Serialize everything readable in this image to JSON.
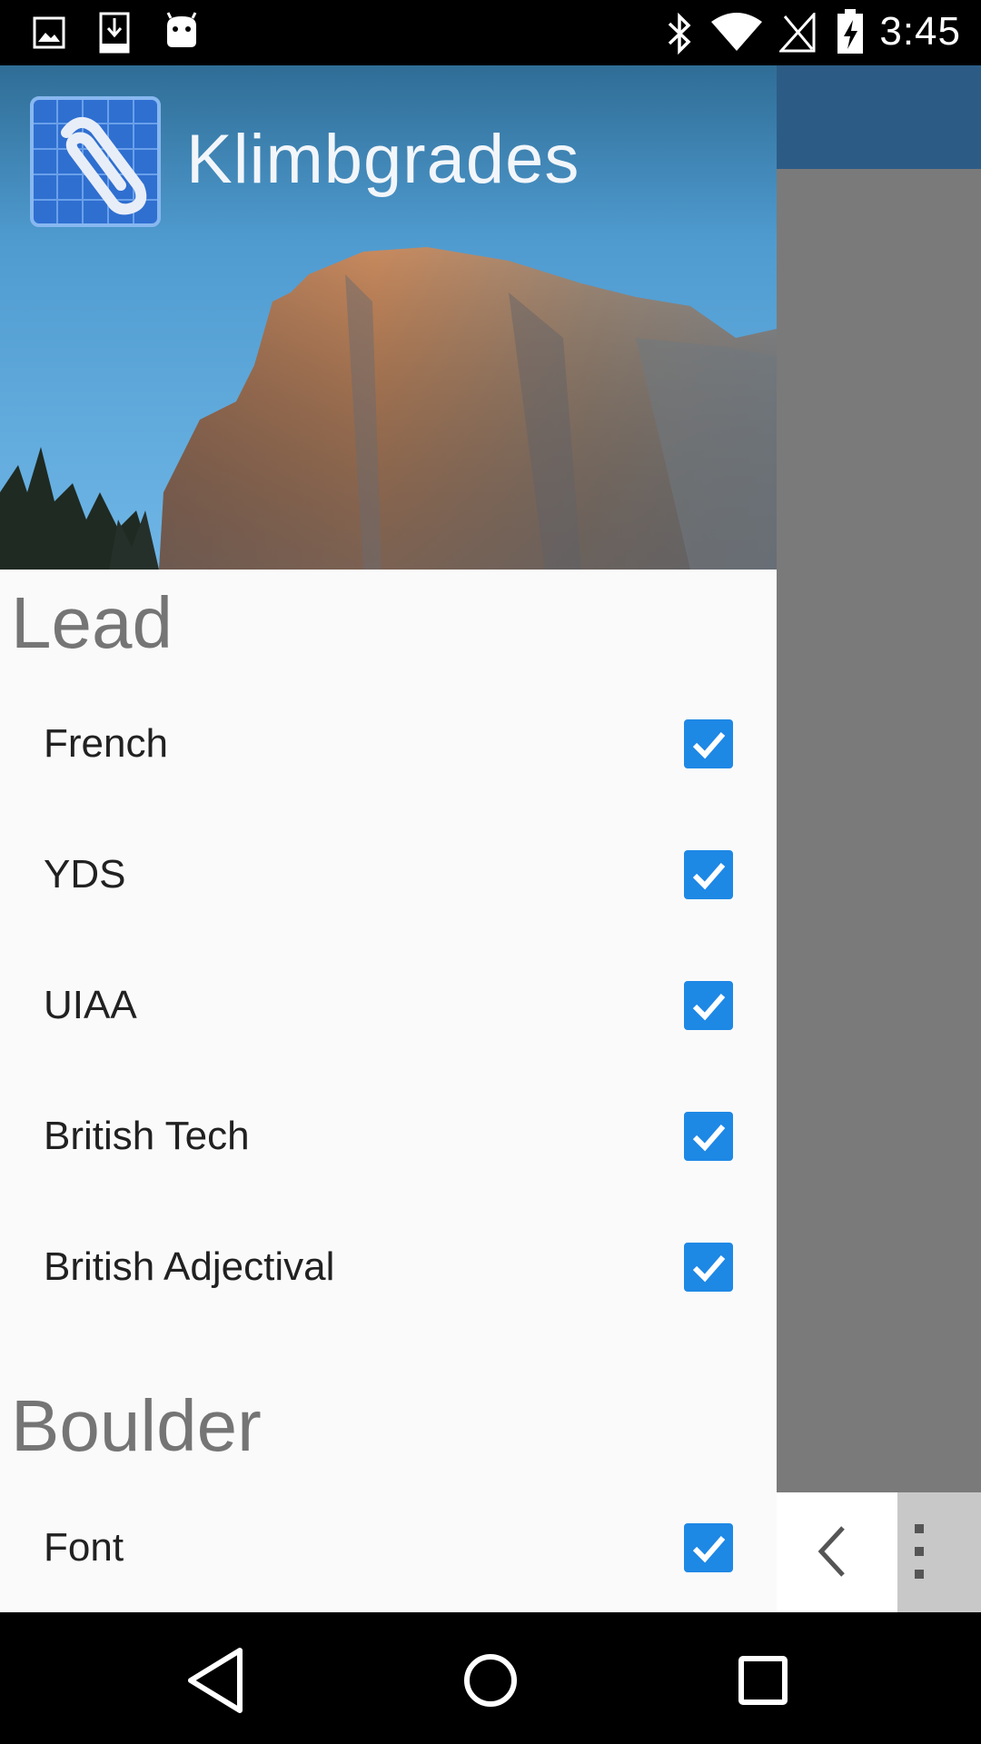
{
  "status_bar": {
    "time": "3:45",
    "left_icons": [
      "gallery-icon",
      "download-icon",
      "android-icon"
    ],
    "right_icons": [
      "bluetooth-icon",
      "wifi-icon",
      "no-signal-icon",
      "battery-charging-icon"
    ]
  },
  "drawer": {
    "app_name": "Klimbgrades",
    "header_image": "half-dome-photo",
    "sections": [
      {
        "title": "Lead",
        "items": [
          {
            "label": "French",
            "checked": true
          },
          {
            "label": "YDS",
            "checked": true
          },
          {
            "label": "UIAA",
            "checked": true
          },
          {
            "label": "British Tech",
            "checked": true
          },
          {
            "label": "British Adjectival",
            "checked": true
          }
        ]
      },
      {
        "title": "Boulder",
        "items": [
          {
            "label": "Font",
            "checked": true
          }
        ]
      }
    ]
  },
  "app": {
    "toolbar_color": "#2c5c86",
    "bottom_icons": [
      "chevron-left-icon",
      "overflow-menu-icon"
    ]
  },
  "colors": {
    "checkbox": "#1e88e5",
    "section_title": "#757575",
    "drawer_bg": "#fafafa"
  },
  "nav_bar": {
    "buttons": [
      "back-icon",
      "home-icon",
      "recents-icon"
    ]
  }
}
